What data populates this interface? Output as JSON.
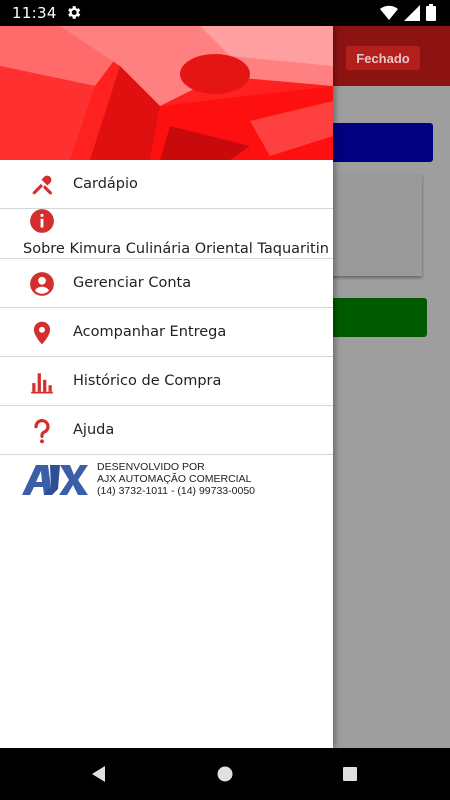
{
  "status_bar": {
    "time": "11:34"
  },
  "background": {
    "status_badge": "Fechado"
  },
  "drawer": {
    "menu": [
      {
        "label": "Cardápio",
        "icon": "utensils-icon"
      },
      {
        "label": "Sobre Kimura Culinária Oriental Taquaritin",
        "icon": "info-icon"
      },
      {
        "label": "Gerenciar Conta",
        "icon": "account-icon"
      },
      {
        "label": "Acompanhar Entrega",
        "icon": "location-pin-icon"
      },
      {
        "label": "Histórico de Compra",
        "icon": "bar-chart-icon"
      },
      {
        "label": "Ajuda",
        "icon": "question-icon"
      }
    ],
    "credits": {
      "line1": "DESENVOLVIDO POR",
      "line2": "AJX AUTOMAÇÃO COMERCIAL",
      "line3": "(14) 3732-1011 - (14) 99733-0050",
      "logo_text": "AJX"
    }
  },
  "colors": {
    "accent": "#d32f2f",
    "header_red": "#ff1a1a",
    "logo_blue": "#3a5fa8"
  }
}
